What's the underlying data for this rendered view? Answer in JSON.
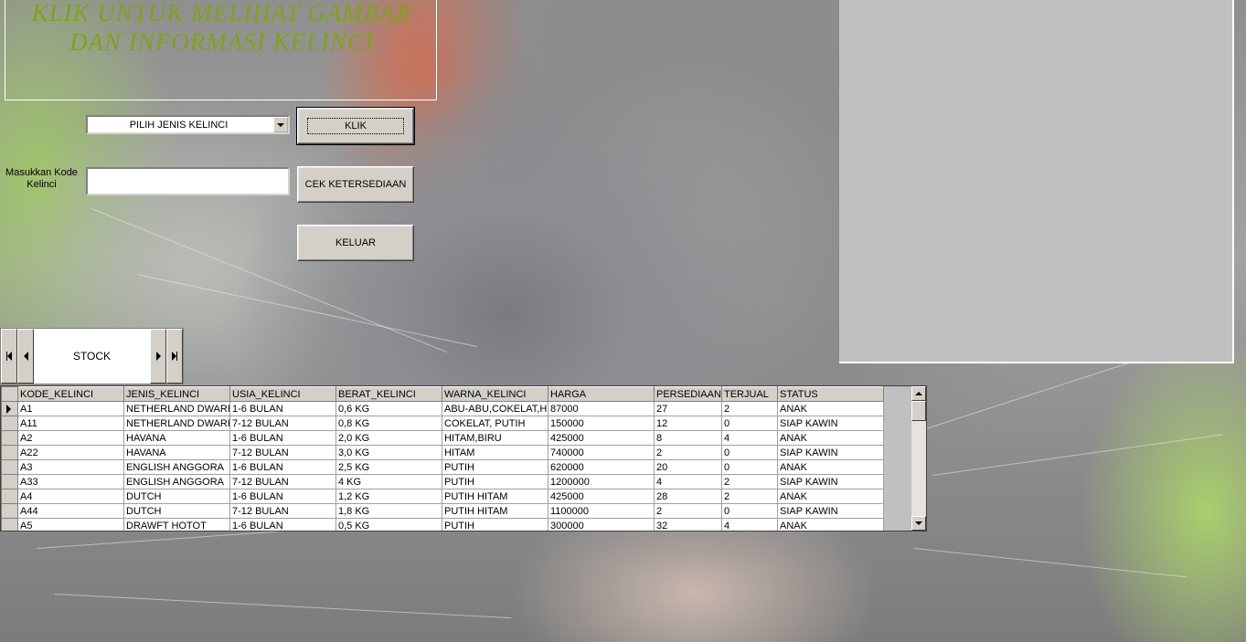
{
  "title": "KLIK UNTUK MELIHAT GAMBAR DAN INFORMASI KELINCI",
  "combo": {
    "value": "PILIH JENIS KELINCI",
    "icon": "chevron-down-icon"
  },
  "buttons": {
    "klik": "KLIK",
    "cek": "CEK KETERSEDIAAN",
    "keluar": "KELUAR"
  },
  "kode_label": "Masukkan Kode Kelinci",
  "kode_input": {
    "value": "",
    "placeholder": ""
  },
  "navigator": {
    "caption": "STOCK",
    "icons": [
      "first-record-icon",
      "prev-record-icon",
      "next-record-icon",
      "last-record-icon"
    ]
  },
  "colors": {
    "title": "#7ea21c",
    "panel": "#c0c0c0",
    "button_face": "#d4d0c8"
  },
  "grid": {
    "columns": [
      "KODE_KELINCI",
      "JENIS_KELINCI",
      "USIA_KELINCI",
      "BERAT_KELINCI",
      "WARNA_KELINCI",
      "HARGA",
      "PERSEDIAAN",
      "TERJUAL",
      "STATUS"
    ],
    "selected_row": 0,
    "rows": [
      [
        "A1",
        "NETHERLAND DWARF",
        "1-6 BULAN",
        "0,6 KG",
        "ABU-ABU,COKELAT,HITAM",
        "87000",
        "27",
        "2",
        "ANAK"
      ],
      [
        "A11",
        "NETHERLAND DWARF",
        "7-12 BULAN",
        "0,8 KG",
        "COKELAT, PUTIH",
        "150000",
        "12",
        "0",
        "SIAP KAWIN"
      ],
      [
        "A2",
        "HAVANA",
        "1-6 BULAN",
        "2,0 KG",
        "HITAM,BIRU",
        "425000",
        "8",
        "4",
        "ANAK"
      ],
      [
        "A22",
        "HAVANA",
        "7-12 BULAN",
        "3,0 KG",
        "HITAM",
        "740000",
        "2",
        "0",
        "SIAP KAWIN"
      ],
      [
        "A3",
        "ENGLISH ANGGORA",
        "1-6 BULAN",
        "2,5 KG",
        "PUTIH",
        "620000",
        "20",
        "0",
        "ANAK"
      ],
      [
        "A33",
        "ENGLISH ANGGORA",
        "7-12 BULAN",
        "4 KG",
        "PUTIH",
        "1200000",
        "4",
        "2",
        "SIAP KAWIN"
      ],
      [
        "A4",
        "DUTCH",
        "1-6 BULAN",
        "1,2 KG",
        "PUTIH HITAM",
        "425000",
        "28",
        "2",
        "ANAK"
      ],
      [
        "A44",
        "DUTCH",
        "7-12 BULAN",
        "1,8 KG",
        "PUTIH HITAM",
        "1100000",
        "2",
        "0",
        "SIAP KAWIN"
      ],
      [
        "A5",
        "DRAWFT HOTOT",
        "1-6 BULAN",
        "0,5 KG",
        "PUTIH",
        "300000",
        "32",
        "4",
        "ANAK"
      ]
    ]
  }
}
